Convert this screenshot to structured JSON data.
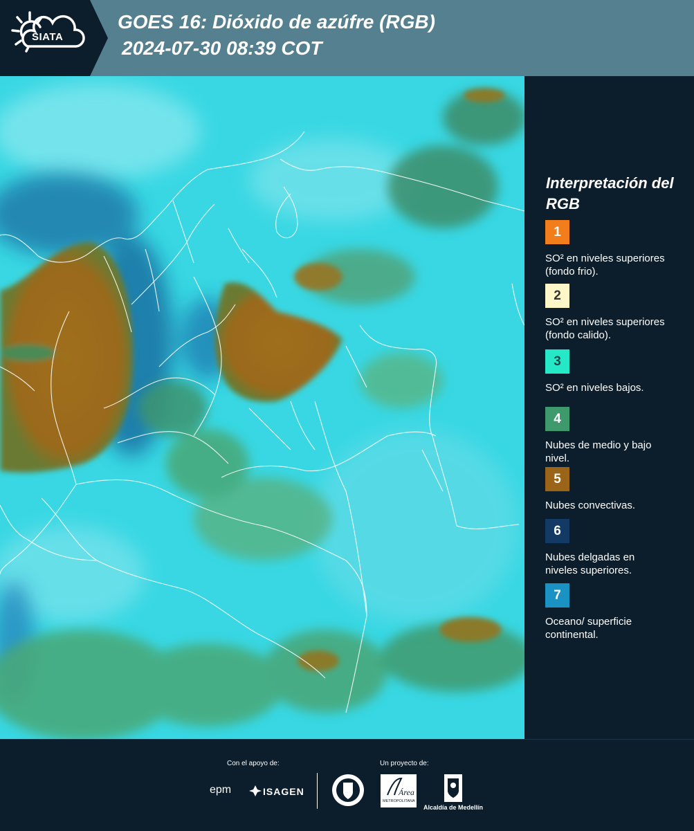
{
  "header": {
    "logo_text": "SIATA",
    "title_line1": "GOES 16: Dióxido de azúfre (RGB)",
    "title_line2": "2024-07-30 08:39 COT"
  },
  "legend": {
    "title": "Interpretación del RGB",
    "items": [
      {
        "number": "1",
        "color": "#f17e1a",
        "text_color": "#ffffff",
        "label": "SO² en niveles superiores (fondo frio)."
      },
      {
        "number": "2",
        "color": "#fdf6c8",
        "text_color": "#333333",
        "label": "SO² en niveles superiores (fondo calido)."
      },
      {
        "number": "3",
        "color": "#25e8c7",
        "text_color": "#1d4a4a",
        "label": "SO² en niveles bajos."
      },
      {
        "number": "4",
        "color": "#3e9a6d",
        "text_color": "#ffffff",
        "label": "Nubes de medio y bajo nivel."
      },
      {
        "number": "5",
        "color": "#9a6518",
        "text_color": "#ffffff",
        "label": "Nubes convectivas."
      },
      {
        "number": "6",
        "color": "#123a64",
        "text_color": "#ffffff",
        "label": "Nubes delgadas en niveles superiores."
      },
      {
        "number": "7",
        "color": "#1a93c2",
        "text_color": "#ffffff",
        "label": "Oceano/ superficie continental."
      }
    ]
  },
  "footer": {
    "support_label": "Con el apoyo de:",
    "project_label": "Un proyecto de:",
    "epm": "epm",
    "isagen": "ISAGEN",
    "amva_text": "Área",
    "amva_sub": "METROPOLITANA",
    "medellin": "Alcaldía de Medellín"
  }
}
